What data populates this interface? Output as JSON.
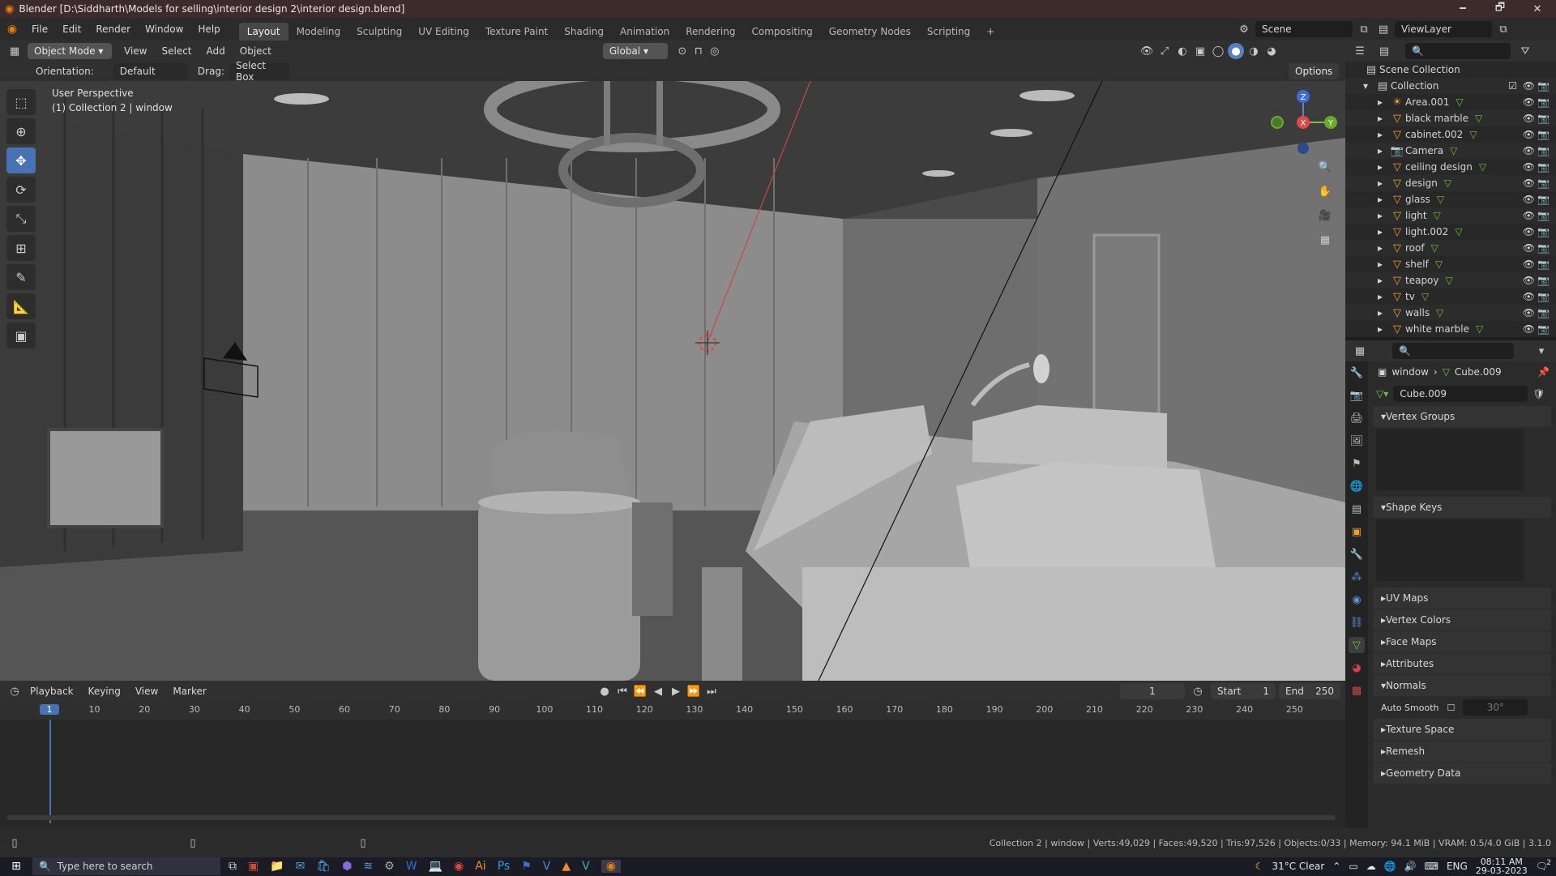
{
  "titlebar": {
    "title": "Blender [D:\\Siddharth\\Models for selling\\interior design 2\\interior design.blend]",
    "minimize": "🗕",
    "restore": "🗗",
    "close": "✕"
  },
  "menus": [
    "File",
    "Edit",
    "Render",
    "Window",
    "Help"
  ],
  "workspaces": [
    "Layout",
    "Modeling",
    "Sculpting",
    "UV Editing",
    "Texture Paint",
    "Shading",
    "Animation",
    "Rendering",
    "Compositing",
    "Geometry Nodes",
    "Scripting"
  ],
  "workspace_add": "+",
  "scene": {
    "name": "Scene",
    "view_layer": "ViewLayer"
  },
  "viewport_header": {
    "mode": "Object Mode",
    "menus": [
      "View",
      "Select",
      "Add",
      "Object"
    ],
    "transform": "Global",
    "options": "Options"
  },
  "tool_header": {
    "orientation_label": "Orientation:",
    "orientation_value": "Default",
    "drag_label": "Drag:",
    "drag_value": "Select Box"
  },
  "viewport": {
    "perspective": "User Perspective",
    "collection": "(1) Collection 2 | window",
    "gizmo": {
      "x": "X",
      "y": "Y",
      "z": "Z"
    }
  },
  "outliner": {
    "root": "Scene Collection",
    "collection": "Collection",
    "items": [
      {
        "name": "Area.001",
        "type": "light"
      },
      {
        "name": "black marble",
        "type": "mesh"
      },
      {
        "name": "cabinet.002",
        "type": "mesh"
      },
      {
        "name": "Camera",
        "type": "camera"
      },
      {
        "name": "ceiling design",
        "type": "mesh"
      },
      {
        "name": "design",
        "type": "mesh"
      },
      {
        "name": "glass",
        "type": "mesh"
      },
      {
        "name": "light",
        "type": "mesh"
      },
      {
        "name": "light.002",
        "type": "mesh"
      },
      {
        "name": "roof",
        "type": "mesh"
      },
      {
        "name": "shelf",
        "type": "mesh"
      },
      {
        "name": "teapoy",
        "type": "mesh"
      },
      {
        "name": "tv",
        "type": "mesh"
      },
      {
        "name": "walls",
        "type": "mesh"
      },
      {
        "name": "white marble",
        "type": "mesh"
      }
    ]
  },
  "properties": {
    "breadcrumb_object": "window",
    "breadcrumb_data": "Cube.009",
    "data_name": "Cube.009",
    "panels": [
      "Vertex Groups",
      "Shape Keys",
      "UV Maps",
      "Vertex Colors",
      "Face Maps",
      "Attributes",
      "Normals",
      "Texture Space",
      "Remesh",
      "Geometry Data"
    ],
    "auto_smooth_label": "Auto Smooth",
    "auto_smooth_angle": "30°"
  },
  "timeline": {
    "menus": [
      "Playback",
      "Keying",
      "View",
      "Marker"
    ],
    "current_frame": "1",
    "start_label": "Start",
    "start": "1",
    "end_label": "End",
    "end": "250",
    "ticks": [
      "1",
      "10",
      "20",
      "30",
      "40",
      "50",
      "60",
      "70",
      "80",
      "90",
      "100",
      "110",
      "120",
      "130",
      "140",
      "150",
      "160",
      "170",
      "180",
      "190",
      "200",
      "210",
      "220",
      "230",
      "240",
      "250"
    ]
  },
  "statusbar": {
    "stats": "Collection 2 | window | Verts:49,029 | Faces:49,520 | Tris:97,526 | Objects:0/33 | Memory: 94.1 MiB | VRAM: 0.5/4.0 GiB | 3.1.0"
  },
  "taskbar": {
    "search_placeholder": "Type here to search",
    "weather": "31°C  Clear",
    "lang": "ENG",
    "time": "08:11 AM",
    "date": "29-03-2023",
    "notif_count": "2"
  },
  "colors": {
    "accent": "#4772b3",
    "titlebar": "#3d2b2b",
    "frame_marker": "#4772b3"
  }
}
